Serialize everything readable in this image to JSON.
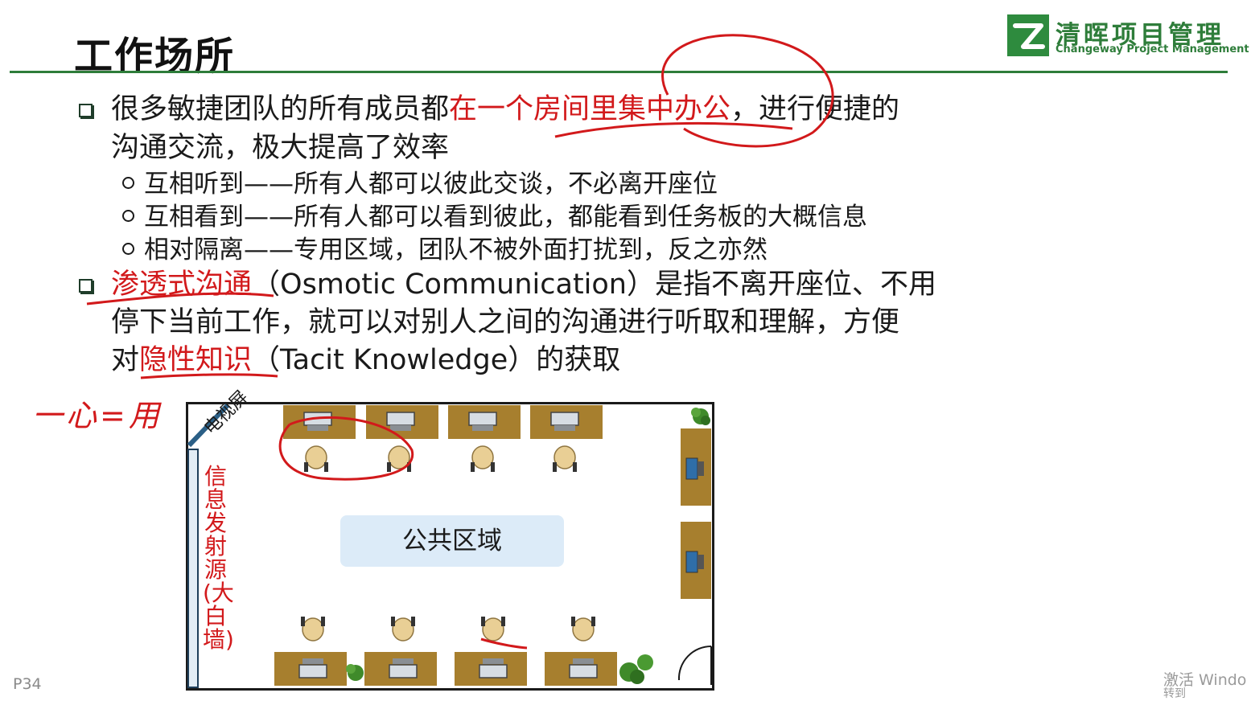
{
  "slide": {
    "title": "工作场所",
    "page_number": "P34"
  },
  "logo": {
    "name_cn": "清晖项目管理",
    "name_en": "Changeway Project Management"
  },
  "bullets": [
    {
      "line1_prefix": "很多敏捷团队的所有成员都",
      "line1_highlight": "在一个房间里集中办公",
      "line1_suffix": "，进行便捷的",
      "line2": "沟通交流，极大提高了效率",
      "subitems": [
        "互相听到——所有人都可以彼此交谈，不必离开座位",
        "互相看到——所有人都可以看到彼此，都能看到任务板的大概信息",
        "相对隔离——专用区域，团队不被外面打扰到，反之亦然"
      ]
    },
    {
      "line1_highlight": "渗透式沟通",
      "line1_suffix": "（Osmotic Communication）是指不离开座位、不用",
      "line2": "停下当前工作，就可以对别人之间的沟通进行听取和理解，方便",
      "line3_prefix": "对",
      "line3_highlight": "隐性知识",
      "line3_suffix": "（Tacit Knowledge）的获取"
    }
  ],
  "floor_plan": {
    "tv_label": "电视屏",
    "wall_label": "信息发射源(大白墙)",
    "public_area": "公共区域"
  },
  "annotation": {
    "handwritten": "一心=用"
  },
  "watermark": {
    "line1": "激活 Windo",
    "line2": "转到"
  },
  "colors": {
    "accent_green": "#2e7d3a",
    "highlight_red": "#d2191b",
    "desk_brown": "#a77f2e",
    "public_area_blue": "#dcebf8"
  }
}
